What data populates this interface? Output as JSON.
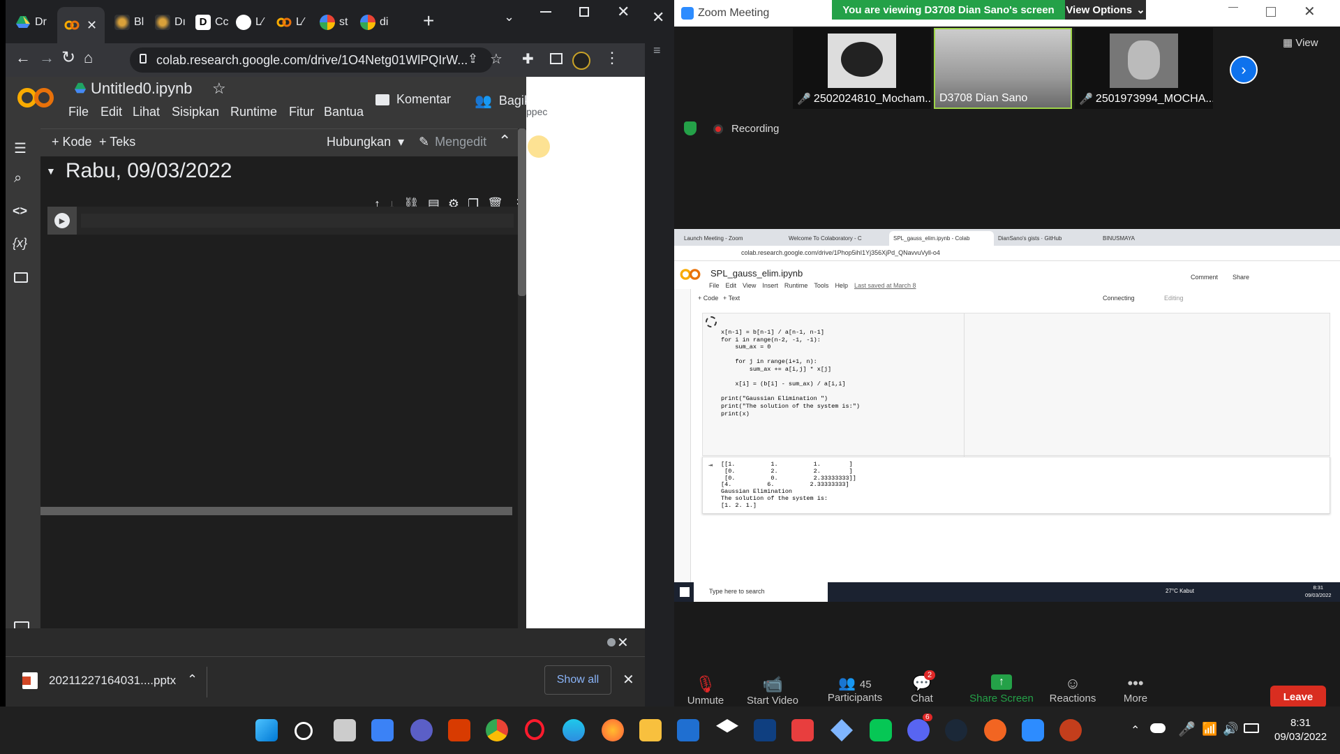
{
  "left_browser": {
    "tabs": [
      {
        "label": "Dr",
        "icon": "drive-icon"
      },
      {
        "label": "",
        "icon": "colab-icon",
        "active": true
      },
      {
        "label": "Bl",
        "icon": "eye-icon"
      },
      {
        "label": "Dı",
        "icon": "eye-icon"
      },
      {
        "label": "Cc",
        "icon": "d-icon"
      },
      {
        "label": "L⁄",
        "icon": "github-icon"
      },
      {
        "label": "L⁄",
        "icon": "colab-icon"
      },
      {
        "label": "st",
        "icon": "google-icon"
      },
      {
        "label": "di",
        "icon": "google-icon"
      }
    ],
    "url": "colab.research.google.com/drive/1O4Netg01WlPQIrW...",
    "notebook_title": "Untitled0.ipynb",
    "menu": [
      "File",
      "Edit",
      "Lihat",
      "Sisipkan",
      "Runtime",
      "Fitur",
      "Bantua"
    ],
    "comment_label": "Komentar",
    "share_label": "Bagikan",
    "add_code": "+ Kode",
    "add_text": "+ Teks",
    "connect_label": "Hubungkan",
    "editing_label": "Mengedit",
    "section_heading": "Rabu, 09/03/2022",
    "side_peek_text": "ppec",
    "download_file": "20211227164031....pptx",
    "show_all": "Show all"
  },
  "zoom": {
    "window_title": "Zoom Meeting",
    "viewing_banner": "You are viewing D3708 Dian Sano's screen",
    "view_options": "View Options",
    "view_label": "View",
    "recording_label": "Recording",
    "participants": [
      {
        "name": "2502024810_Mocham...",
        "muted": true
      },
      {
        "name": "D3708 Dian Sano",
        "muted": false
      },
      {
        "name": "2501973994_MOCHA...",
        "muted": true
      }
    ],
    "controls": {
      "unmute": "Unmute",
      "start_video": "Start Video",
      "participants": "Participants",
      "participants_count": "45",
      "chat": "Chat",
      "chat_badge": "2",
      "share_screen": "Share Screen",
      "reactions": "Reactions",
      "more": "More",
      "leave": "Leave"
    }
  },
  "shared_screen": {
    "tabs": [
      "Launch Meeting - Zoom",
      "Welcome To Colaboratory - C",
      "SPL_gauss_elim.ipynb - Colab",
      "DianSano's gists · GitHub",
      "BINUSMAYA"
    ],
    "url": "colab.research.google.com/drive/1Phop5ihI1Yj356XjPd_QNavvuVyll-o4",
    "notebook_title": "SPL_gauss_elim.ipynb",
    "menu": [
      "File",
      "Edit",
      "View",
      "Insert",
      "Runtime",
      "Tools",
      "Help"
    ],
    "last_saved": "Last saved at March 8",
    "comment": "Comment",
    "share": "Share",
    "add_code": "+ Code",
    "add_text": "+ Text",
    "connecting": "Connecting",
    "editing": "Editing",
    "code_lines": [
      "x[n-1] = b[n-1] / a[n-1, n-1]",
      "for i in range(n-2, -1, -1):",
      "    sum_ax = 0",
      "",
      "    for j in range(i+1, n):",
      "        sum_ax += a[i,j] * x[j]",
      "",
      "    x[i] = (b[i] - sum_ax) / a[i,i]",
      "",
      "print(\"Gaussian Elimination \")",
      "print(\"The solution of the system is:\")",
      "print(x)"
    ],
    "output_lines": [
      "[[1.          1.          1.        ]",
      " [0.          2.          2.        ]",
      " [0.          0.          2.33333333]]",
      "[4.          6.          2.33333333]",
      "Gaussian Elimination",
      "The solution of the system is:",
      "[1. 2. 1.]"
    ],
    "search_placeholder": "Type here to search",
    "weather": "27°C  Kabut",
    "time": "8:31",
    "date": "09/03/2022"
  },
  "taskbar": {
    "discord_badge": "6",
    "time": "8:31",
    "date": "09/03/2022"
  }
}
